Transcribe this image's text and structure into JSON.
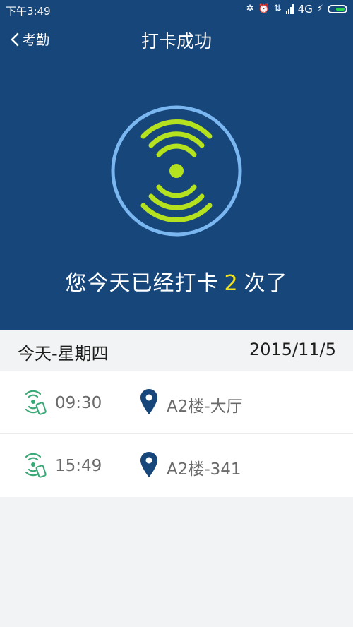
{
  "status_bar": {
    "time": "下午3:49",
    "network": "4G",
    "icons": [
      "bluetooth-icon",
      "alarm-icon",
      "data-arrows-icon",
      "signal-icon",
      "charging-icon",
      "battery-icon"
    ]
  },
  "nav": {
    "back_label": "考勤",
    "title": "打卡成功"
  },
  "hero": {
    "message_prefix": "您今天已经打卡",
    "count": "2",
    "message_suffix": "次了",
    "icon": "nfc-wave-icon",
    "colors": {
      "background": "#16467a",
      "ring": "#7ab6f0",
      "waves": "#b4e21f",
      "count": "#f2e21f"
    }
  },
  "day": {
    "label": "今天-星期四",
    "date": "2015/11/5"
  },
  "records": [
    {
      "time": "09:30",
      "place": "A2楼-大厅"
    },
    {
      "time": "15:49",
      "place": "A2楼-341"
    }
  ]
}
